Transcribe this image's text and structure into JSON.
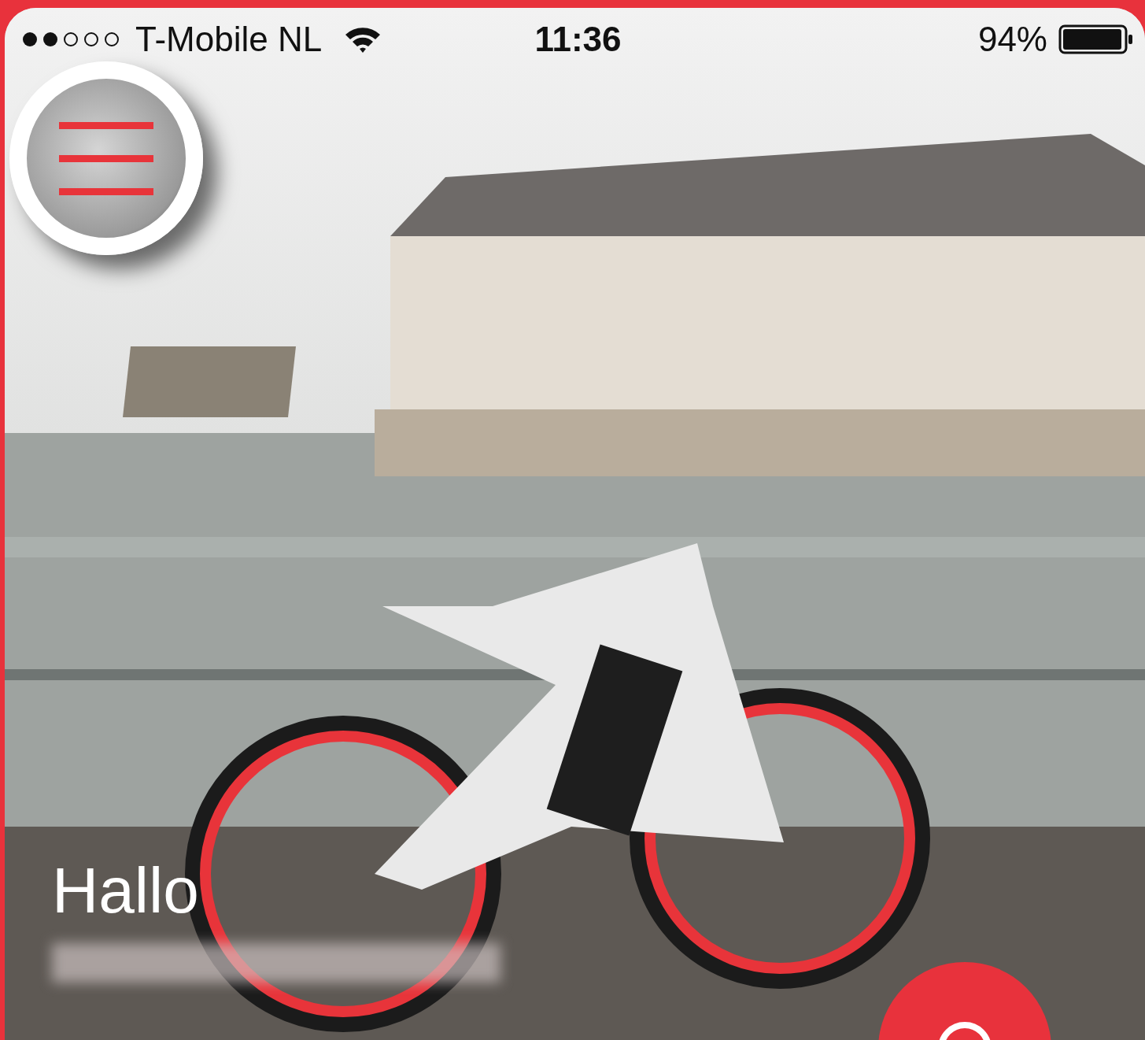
{
  "status_bar": {
    "carrier": "T-Mobile NL",
    "time": "11:36",
    "battery": "94%"
  },
  "greeting": "Hallo"
}
